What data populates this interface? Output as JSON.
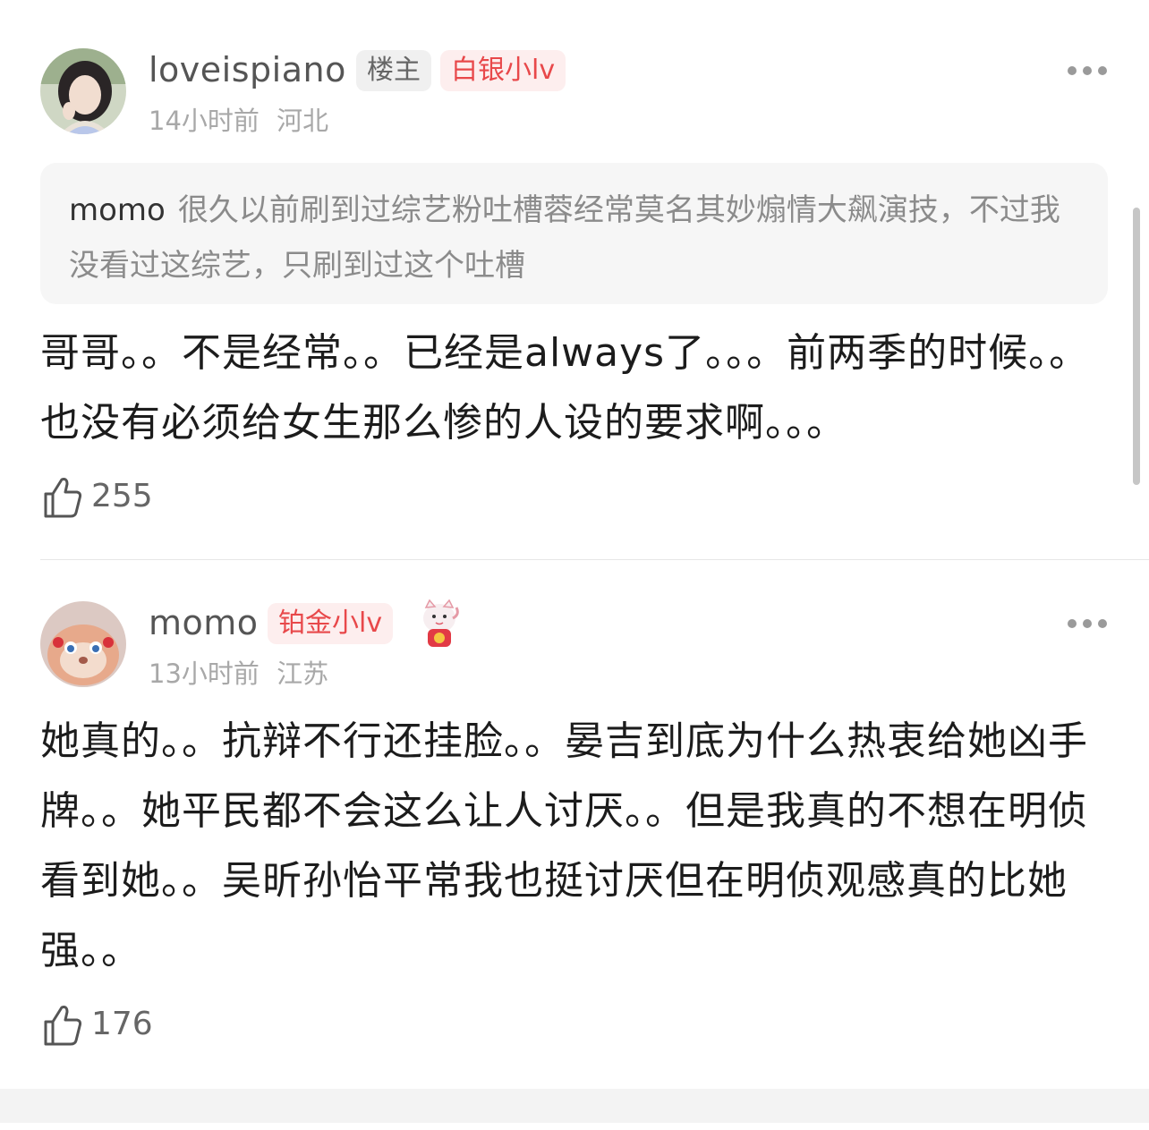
{
  "comments": [
    {
      "username": "loveispiano",
      "owner_tag": "楼主",
      "level_tag": "白银小lv",
      "time": "14小时前",
      "location": "河北",
      "quote": {
        "user": "momo",
        "text": "很久以前刷到过综艺粉吐槽蓉经常莫名其妙煽情大飙演技，不过我没看过这综艺，只刷到过这个吐槽"
      },
      "text": "哥哥。。不是经常。。已经是always了。。。前两季的时候。。也没有必须给女生那么惨的人设的要求啊。。。",
      "likes": "255"
    },
    {
      "username": "momo",
      "level_tag": "铂金小lv",
      "time": "13小时前",
      "location": "江苏",
      "text": "她真的。。抗辩不行还挂脸。。晏吉到底为什么热衷给她凶手牌。。她平民都不会这么让人讨厌。。但是我真的不想在明侦看到她。。吴昕孙怡平常我也挺讨厌但在明侦观感真的比她强。。",
      "likes": "176"
    }
  ],
  "icons": {
    "like": "thumbs-up-icon",
    "more": "more-dots-icon",
    "badge": "lucky-cat-badge-icon"
  },
  "colors": {
    "level_tag_text": "#e8484a",
    "level_tag_bg": "#fdeeee",
    "owner_tag_bg": "#f0f0f0"
  }
}
